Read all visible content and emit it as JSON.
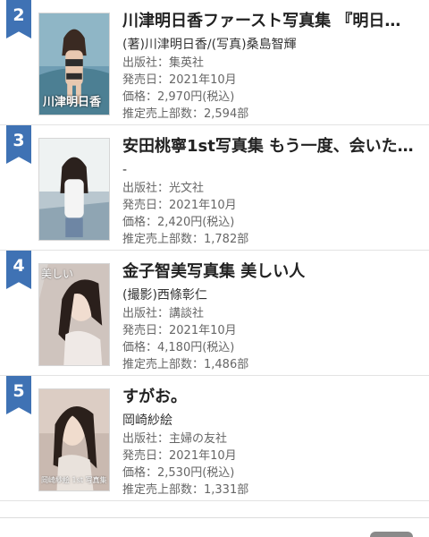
{
  "books": [
    {
      "rank": "2",
      "title": "川津明日香ファースト写真集 『明日…",
      "author": "(著)川津明日香/(写真)桑島智輝",
      "publisher": "出版社：集英社",
      "release": "発売日：2021年10月",
      "price": "価格：2,970円(税込)",
      "sales": "推定売上部数：2,594部",
      "cover_text": "川津明日香"
    },
    {
      "rank": "3",
      "title": "安田桃寧1st写真集 もう一度、会いた…",
      "author": "-",
      "publisher": "出版社：光文社",
      "release": "発売日：2021年10月",
      "price": "価格：2,420円(税込)",
      "sales": "推定売上部数：1,782部",
      "cover_text": ""
    },
    {
      "rank": "4",
      "title": "金子智美写真集 美しい人",
      "author": "(撮影)西條彰仁",
      "publisher": "出版社：講談社",
      "release": "発売日：2021年10月",
      "price": "価格：4,180円(税込)",
      "sales": "推定売上部数：1,486部",
      "cover_text": "美しい"
    },
    {
      "rank": "5",
      "title": "すがお。",
      "author": "岡崎紗絵",
      "publisher": "出版社：主婦の友社",
      "release": "発売日：2021年10月",
      "price": "価格：2,530円(税込)",
      "sales": "推定売上部数：1,331部",
      "cover_text": "岡崎紗絵 1st 写真集"
    }
  ],
  "colors": {
    "rank_badge": "#3f72b4",
    "divider": "#e3e3e3"
  }
}
